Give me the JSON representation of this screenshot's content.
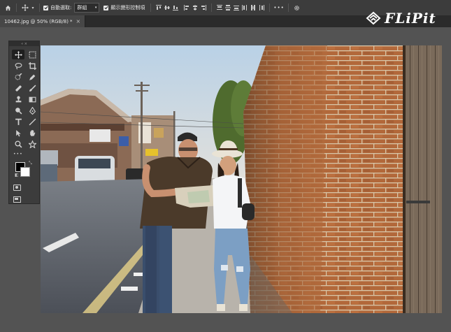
{
  "options_bar": {
    "auto_select_label": "自動選取:",
    "auto_select_value": "群組",
    "transform_controls_label": "顯示變形控制項",
    "more_label": "•••"
  },
  "document_tab": {
    "title": "10462.jpg @ 50% (RGB/8)",
    "modified_mark": "*",
    "close_glyph": "×"
  },
  "logo": {
    "text": "FLiPit"
  },
  "tools_panel": {
    "collapse_glyph": "« ×",
    "more_glyph": "•••",
    "foreground_color": "#000000",
    "background_color": "#ffffff"
  },
  "canvas": {
    "content": "photograph"
  },
  "colors": {
    "app_background": "#535353",
    "panel": "#3c3c3c",
    "tab_bar": "#2b2b2b"
  }
}
